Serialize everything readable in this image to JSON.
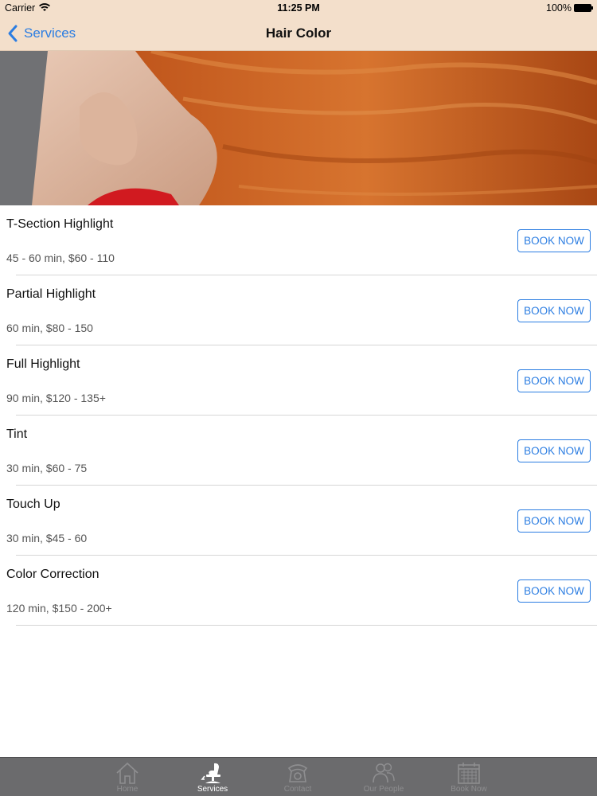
{
  "status_bar": {
    "carrier": "Carrier",
    "time": "11:25 PM",
    "battery": "100%"
  },
  "nav_bar": {
    "back_label": "Services",
    "title": "Hair Color"
  },
  "services": [
    {
      "name": "T-Section Highlight",
      "detail": "45 - 60 min, $60 - 110",
      "button": "BOOK NOW"
    },
    {
      "name": "Partial Highlight",
      "detail": "60 min, $80 - 150",
      "button": "BOOK NOW"
    },
    {
      "name": "Full Highlight",
      "detail": "90 min, $120 - 135+",
      "button": "BOOK NOW"
    },
    {
      "name": "Tint",
      "detail": "30 min, $60 - 75",
      "button": "BOOK NOW"
    },
    {
      "name": "Touch Up",
      "detail": "30 min, $45 - 60",
      "button": "BOOK NOW"
    },
    {
      "name": "Color Correction",
      "detail": "120 min, $150 - 200+",
      "button": "BOOK NOW"
    }
  ],
  "tab_bar": {
    "tabs": [
      {
        "label": "Home",
        "icon": "house-icon",
        "active": false
      },
      {
        "label": "Services",
        "icon": "salon-chair-icon",
        "active": true
      },
      {
        "label": "Contact",
        "icon": "phone-icon",
        "active": false
      },
      {
        "label": "Our People",
        "icon": "people-icon",
        "active": false
      },
      {
        "label": "Book Now",
        "icon": "calendar-icon",
        "active": false
      }
    ]
  },
  "colors": {
    "accent": "#2b7de2",
    "nav_background": "#f3dfcb",
    "tab_background": "#6b6b6d"
  }
}
